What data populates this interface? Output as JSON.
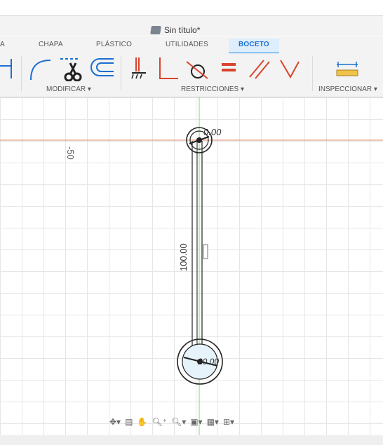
{
  "document": {
    "title": "Sin título*"
  },
  "tabs": [
    {
      "label": "A"
    },
    {
      "label": "CHAPA"
    },
    {
      "label": "PLÁSTICO"
    },
    {
      "label": "UTILIDADES"
    },
    {
      "label": "BOCETO"
    }
  ],
  "groups": {
    "modificar": "MODIFICAR ▾",
    "restricciones": "RESTRICCIONES ▾",
    "inspeccionar": "INSPECCIONAR ▾"
  },
  "canvas": {
    "axis_label": "-50",
    "dimension_length": "100.00",
    "top_circle_dims": "0.00",
    "bottom_circle_dims": "20.00"
  },
  "colors": {
    "accent": "#1a88e5",
    "x_axis": "#e08a6a",
    "y_axis": "#7fd47f",
    "sketch": "#222222",
    "constraint_red": "#d9442c"
  },
  "navbar": {
    "orbit": "orbit-icon",
    "look": "look-at-icon",
    "pan": "pan-icon",
    "zoom": "zoom-icon",
    "fit": "fit-icon",
    "display": "display-settings-icon",
    "grid": "grid-icon",
    "viewports": "viewports-icon"
  }
}
